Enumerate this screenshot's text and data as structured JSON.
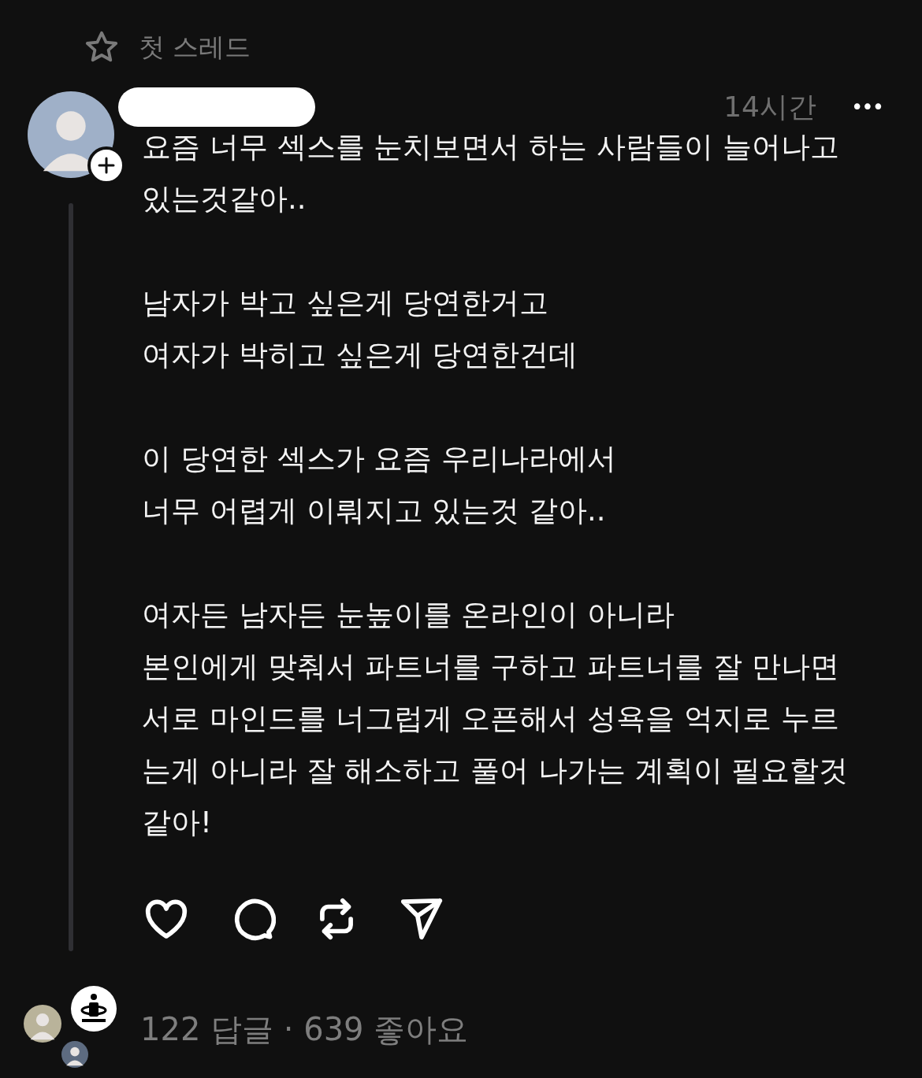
{
  "thread_header": {
    "label": "첫 스레드"
  },
  "post": {
    "time": "14시간",
    "more": "•••",
    "paragraphs": [
      "요즘 너무 섹스를 눈치보면서 하는 사람들이 늘어나고\n있는것같아..",
      "남자가 박고 싶은게 당연한거고\n여자가 박히고 싶은게 당연한건데",
      "이 당연한 섹스가 요즘 우리나라에서\n너무 어렵게 이뤄지고 있는것 같아..",
      "여자든 남자든 눈높이를 온라인이 아니라\n본인에게 맞춰서 파트너를 구하고 파트너를 잘 만나면\n서로 마인드를 너그럽게 오픈해서 성욕을 억지로 누르\n는게 아니라 잘 해소하고 풀어 나가는 계획이 필요할것\n같아!"
    ]
  },
  "footer": {
    "stats": "122 답글 · 639 좋아요"
  }
}
